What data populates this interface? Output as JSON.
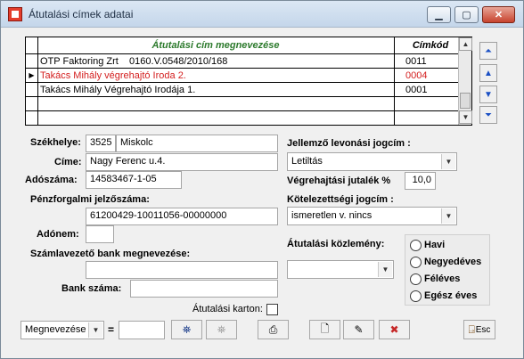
{
  "window": {
    "title": "Átutalási címek adatai"
  },
  "grid": {
    "headers": {
      "name": "Átutalási cím megnevezése",
      "code": "Címkód"
    },
    "rows": [
      {
        "name": "OTP Faktoring Zrt    0160.V.0548/2010/168",
        "code": "0011",
        "highlighted": false,
        "current": false
      },
      {
        "name": "Takács Mihály végrehajtó Iroda 2.",
        "code": "0004",
        "highlighted": true,
        "current": true
      },
      {
        "name": "Takács Mihály Végrehajtó Irodája 1.",
        "code": "0001",
        "highlighted": false,
        "current": false
      },
      {
        "name": "",
        "code": "",
        "highlighted": false,
        "current": false
      },
      {
        "name": "",
        "code": "",
        "highlighted": false,
        "current": false
      }
    ],
    "current_row_marker": "▶"
  },
  "form": {
    "szekhely_label": "Székhelye:",
    "zip": "3525",
    "city": "Miskolc",
    "cime_label": "Címe:",
    "address": "Nagy Ferenc u.4.",
    "adoszam_label": "Adószáma:",
    "tax_number": "14583467-1-05",
    "penzforgalmi_label": "Pénzforgalmi jelzőszáma:",
    "account_number": "61200429-10011056-00000000",
    "adonem_label": "Adónem:",
    "adonem_value": "",
    "bank_name_label": "Számlavezető bank megnevezése:",
    "bank_name": "",
    "bank_code_label": "Bank száma:",
    "bank_code": "",
    "jellemzo_label": "Jellemző levonási jogcím :",
    "jellemzo_value": "Letiltás",
    "jutalek_label": "Végrehajtási jutalék %",
    "jutalek_value": "10,0",
    "kotelezettsegi_label": "Kötelezettségi jogcím :",
    "kotelezettsegi_value": "ismeretlen v. nincs",
    "kozlemeny_label": "Átutalási közlemény:",
    "kozlemeny_value": "",
    "karton_label": "Átutalási karton:",
    "karton_checked": false
  },
  "periodicity": {
    "options": [
      "Havi",
      "Negyedéves",
      "Féléves",
      "Egész éves"
    ],
    "selected": null
  },
  "toolbar": {
    "search_field": "Megnevezése",
    "equals": "=",
    "search_value": "",
    "esc_label": "Esc"
  },
  "icons": {
    "nav": [
      "nav-first-icon",
      "nav-prev-icon",
      "nav-next-icon",
      "nav-last-icon"
    ],
    "search": "binoculars-icon",
    "search_next": "binoculars-disabled-icon",
    "print": "printer-icon",
    "new": "new-document-icon",
    "edit": "edit-document-icon",
    "delete": "delete-document-icon",
    "exit": "exit-door-icon"
  },
  "colors": {
    "header_text": "#2c7a2c",
    "highlight_row_text": "#d42020",
    "nav_arrow": "#1a4fc4"
  }
}
